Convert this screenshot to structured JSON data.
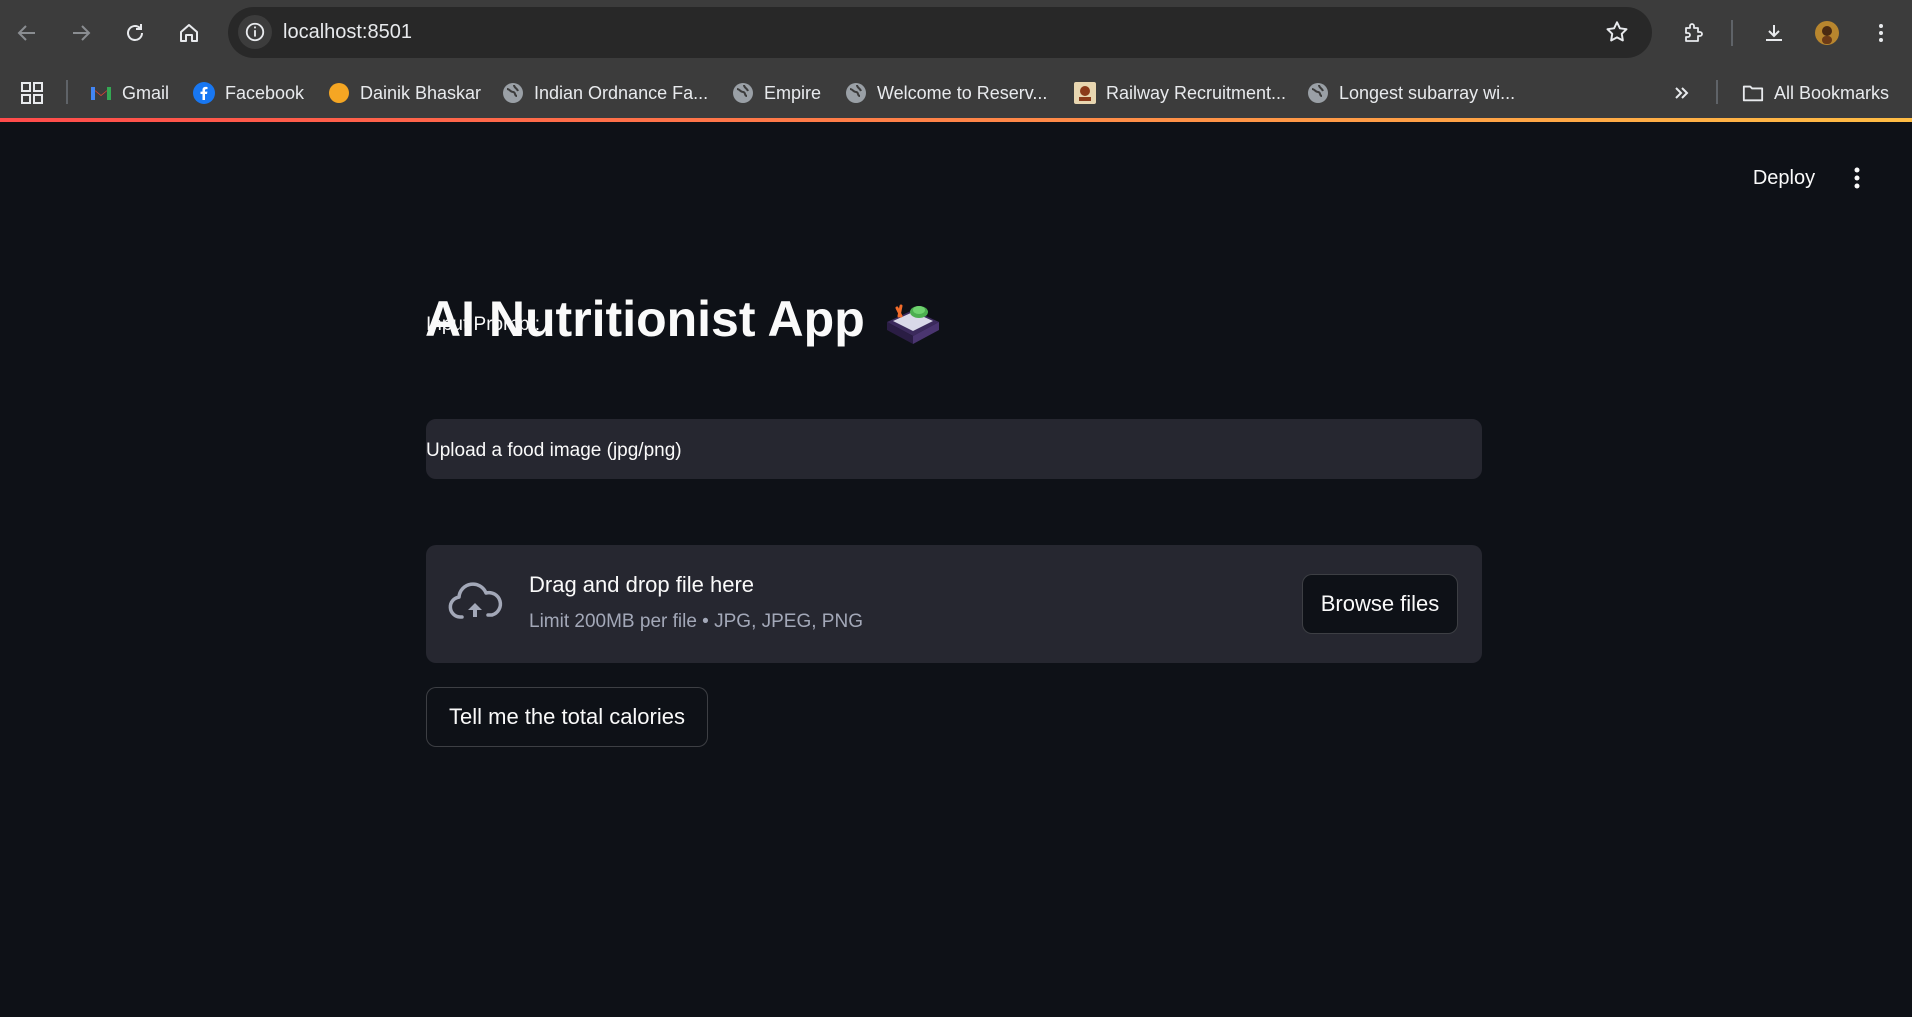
{
  "browser": {
    "url": "localhost:8501",
    "nav": {
      "back_icon": "arrow-left-icon",
      "forward_icon": "arrow-right-icon",
      "reload_icon": "reload-icon",
      "home_icon": "home-icon"
    },
    "bookmarks": [
      {
        "label": "Gmail",
        "icon": "gmail-icon"
      },
      {
        "label": "Facebook",
        "icon": "facebook-icon"
      },
      {
        "label": "Dainik Bhaskar",
        "icon": "dainik-bhaskar-icon"
      },
      {
        "label": "Indian Ordnance Fa...",
        "icon": "globe-icon"
      },
      {
        "label": "Empire",
        "icon": "globe-icon"
      },
      {
        "label": "Welcome to Reserv...",
        "icon": "globe-icon"
      },
      {
        "label": "Railway Recruitment...",
        "icon": "railway-logo-icon"
      },
      {
        "label": "Longest subarray wi...",
        "icon": "globe-icon"
      }
    ],
    "more_bookmarks_icon": "chevron-double-right-icon",
    "all_bookmarks_label": "All Bookmarks"
  },
  "app": {
    "deploy_label": "Deploy",
    "title": "AI Nutritionist App",
    "input_label": "Input Prompt:",
    "input_value": "",
    "upload_label": "Upload a food image (jpg/png)",
    "dropzone_main": "Drag and drop file here",
    "dropzone_sub": "Limit 200MB per file • JPG, JPEG, PNG",
    "browse_label": "Browse files",
    "submit_label": "Tell me the total calories"
  },
  "colors": {
    "background": "#0e1117",
    "widget_bg": "#262730",
    "text": "#fafafa",
    "muted_text": "#a3a8b8",
    "accent_start": "#ff4b4b",
    "accent_end": "#ffbd45"
  }
}
